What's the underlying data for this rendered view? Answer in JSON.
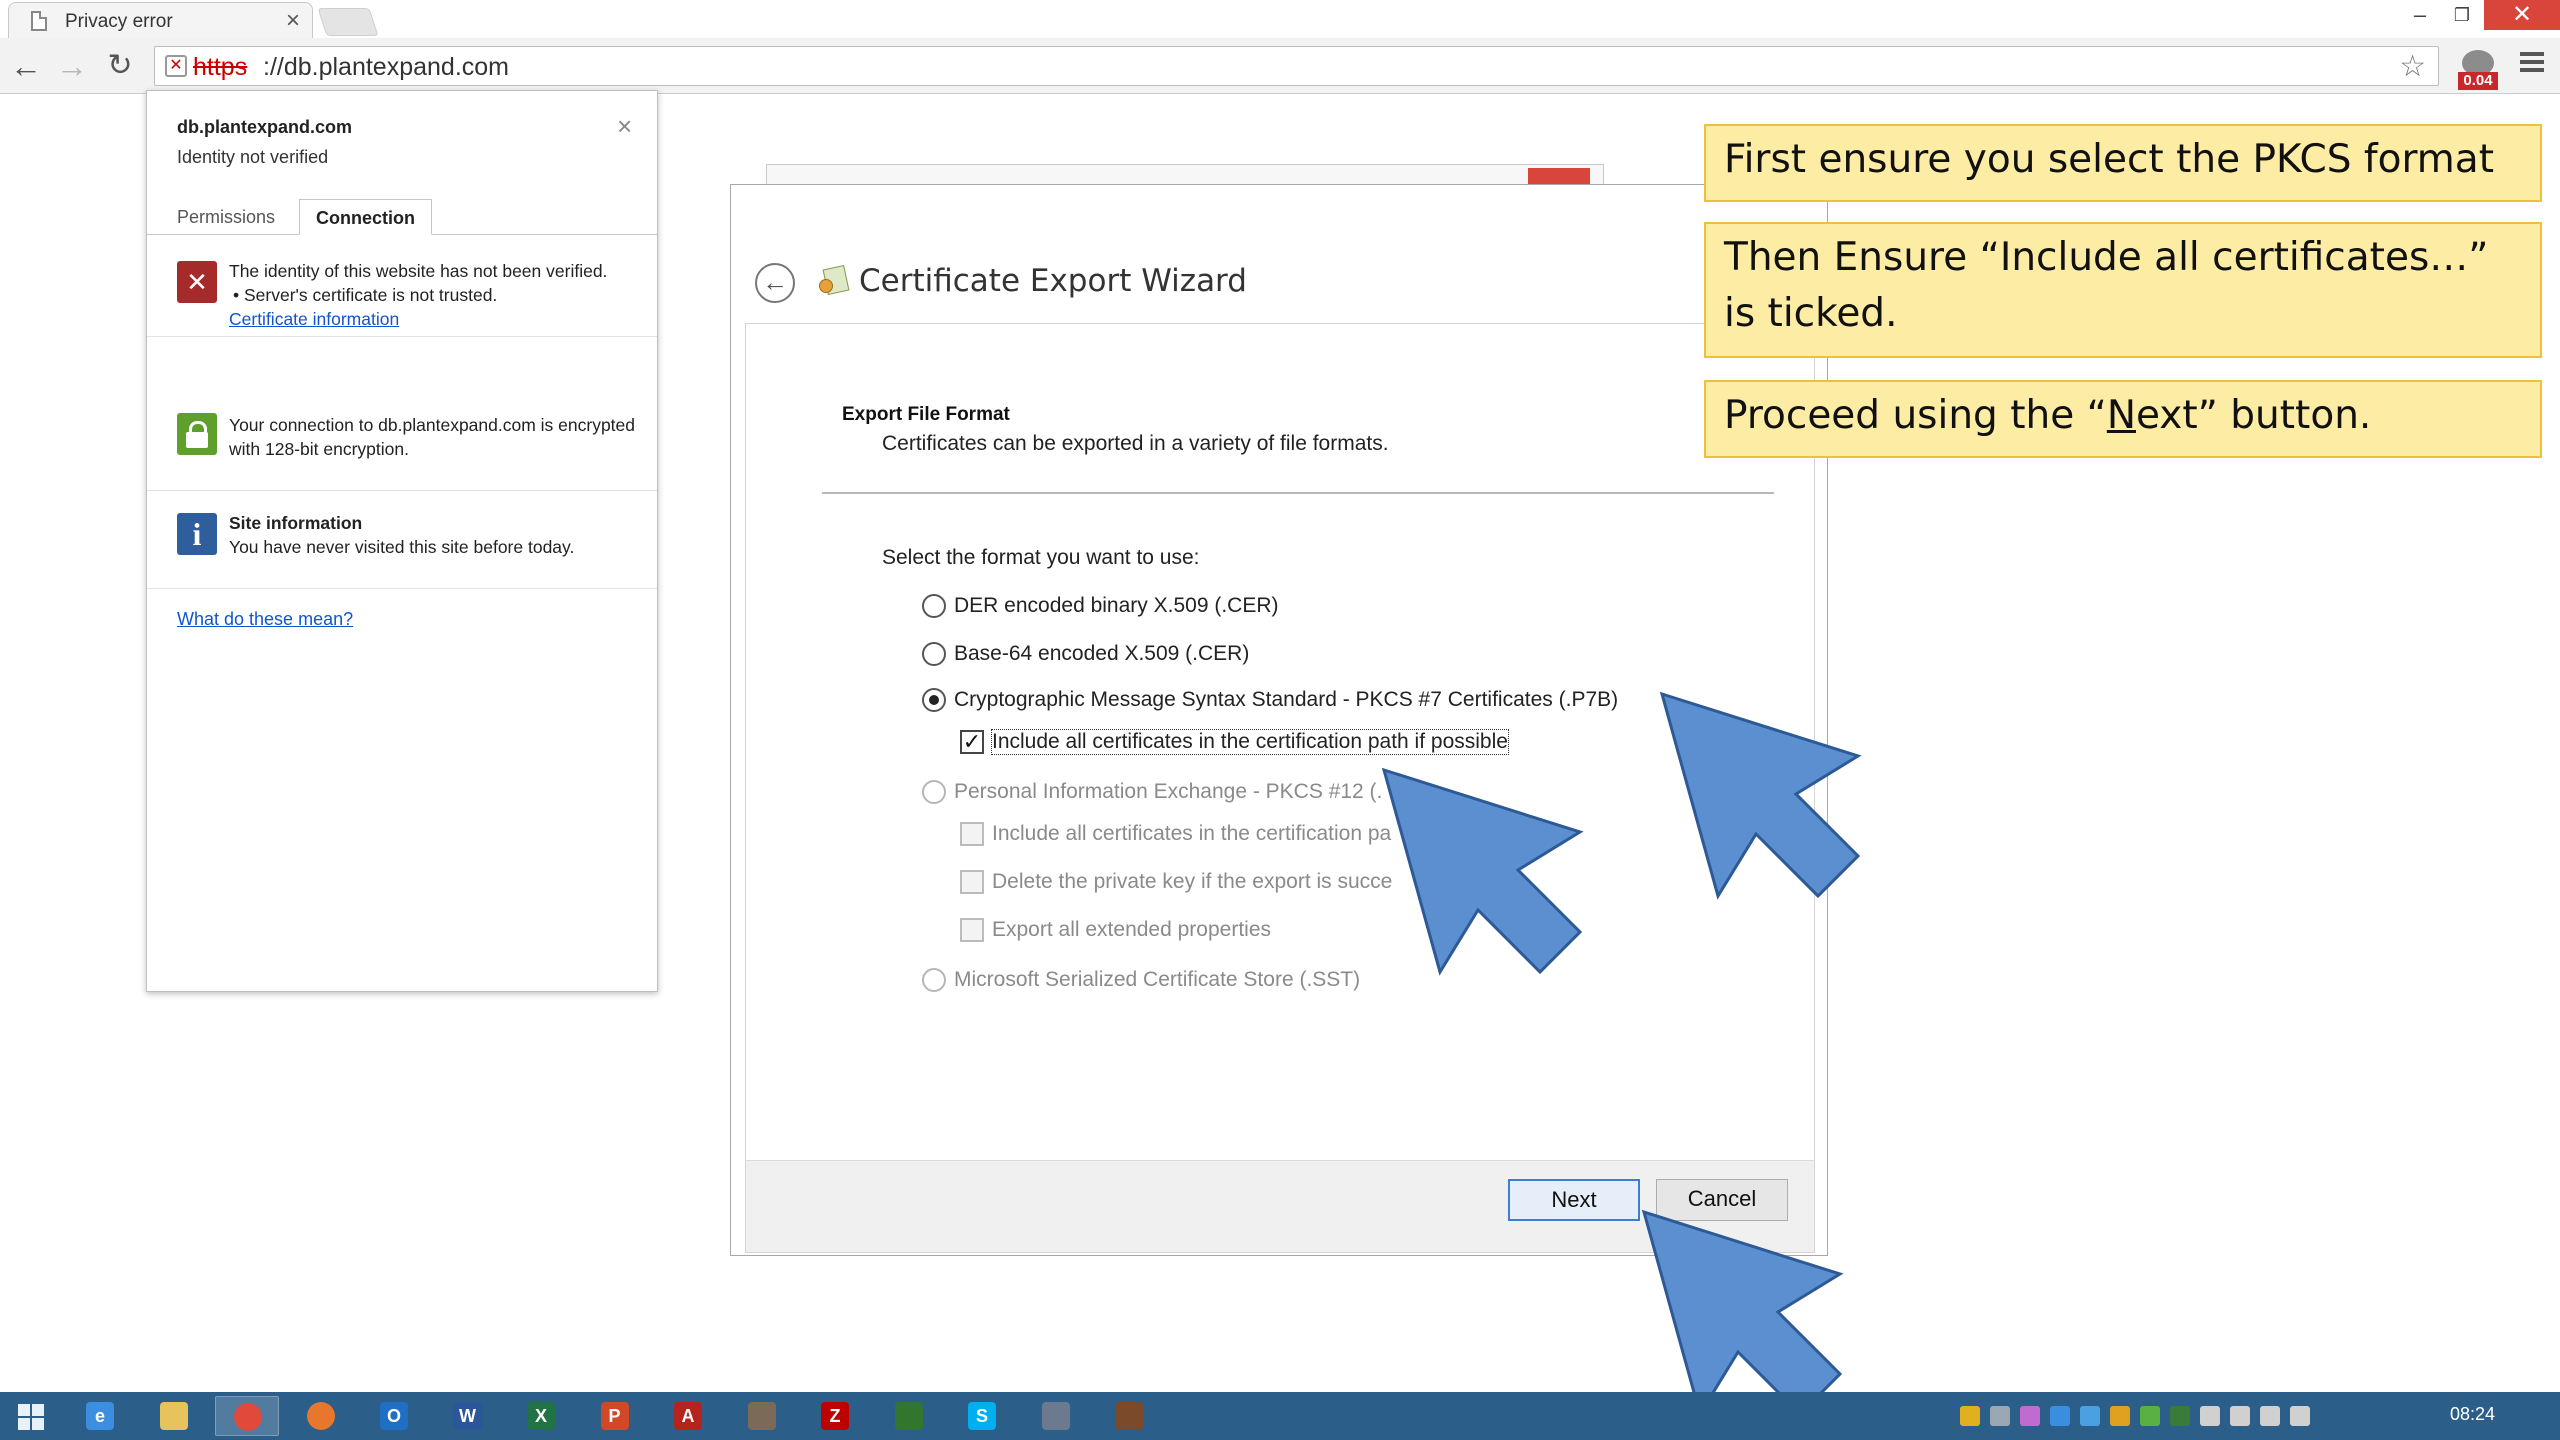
{
  "browser": {
    "tab_title": "Privacy error",
    "tab_close": "×",
    "window_min": "–",
    "window_max": "❐",
    "window_close": "✕",
    "url_scheme": "https",
    "url_rest": "://db.plantexpand.com",
    "extension_badge": "0.04",
    "icons": [
      "back-arrow-icon",
      "forward-arrow-icon",
      "reload-icon",
      "insecure-lock-icon",
      "bookmark-star-icon",
      "menu-icon"
    ]
  },
  "site_info": {
    "domain": "db.plantexpand.com",
    "identity": "Identity not verified",
    "close": "×",
    "tab_permissions": "Permissions",
    "tab_connection": "Connection",
    "identity_line1": "The identity of this website has not been verified.",
    "identity_line2": "• Server's certificate is not trusted.",
    "certificate_link": "Certificate information",
    "connection_text": "Your connection to db.plantexpand.com is encrypted with 128-bit encryption.",
    "site_info_title": "Site information",
    "site_info_text": "You have never visited this site before today.",
    "help_link": "What do these mean?"
  },
  "wizard": {
    "back": "←",
    "title": "Certificate Export Wizard",
    "heading": "Export File Format",
    "subheading": "Certificates can be exported in a variety of file formats.",
    "prompt": "Select the format you want to use:",
    "opt_der": "DER encoded binary X.509 (.CER)",
    "opt_base64": "Base-64 encoded X.509 (.CER)",
    "opt_pkcs7": "Cryptographic Message Syntax Standard - PKCS #7 Certificates (.P7B)",
    "chk_include_pkcs7": "Include all certificates in the certification path if possible",
    "opt_pkcs12": "Personal Information Exchange - PKCS #12 (.",
    "chk_include_pkcs12": "Include all certificates in the certification pa",
    "chk_delete_key": "Delete the private key if the export is succe",
    "chk_export_ext": "Export all extended properties",
    "opt_sst": "Microsoft Serialized Certificate Store (.SST)",
    "next": "Next",
    "cancel": "Cancel",
    "selected_format": "pkcs7",
    "include_all_checked": true
  },
  "callouts": {
    "c1": "First ensure you select the PKCS format",
    "c2": "Then Ensure “Include all certificates…” is ticked.",
    "c3_before": "Proceed using the “",
    "c3_key": "N",
    "c3_after": "ext” button."
  },
  "taskbar": {
    "clock": "08:24",
    "apps": [
      {
        "name": "internet-explorer",
        "label": "e",
        "color": "#3b8ee0"
      },
      {
        "name": "file-explorer",
        "label": "",
        "color": "#e8c25a"
      },
      {
        "name": "chrome",
        "label": "",
        "color": "#e04a3a"
      },
      {
        "name": "firefox",
        "label": "",
        "color": "#e8772e"
      },
      {
        "name": "outlook",
        "label": "O",
        "color": "#1f6fc4"
      },
      {
        "name": "word",
        "label": "W",
        "color": "#2b579a"
      },
      {
        "name": "excel",
        "label": "X",
        "color": "#217346"
      },
      {
        "name": "powerpoint",
        "label": "P",
        "color": "#d24726"
      },
      {
        "name": "acrobat",
        "label": "A",
        "color": "#b5231d"
      },
      {
        "name": "gimp",
        "label": "",
        "color": "#7b6a55"
      },
      {
        "name": "filezilla",
        "label": "Z",
        "color": "#bf0000"
      },
      {
        "name": "project",
        "label": "",
        "color": "#31752f"
      },
      {
        "name": "skype",
        "label": "S",
        "color": "#00aff0"
      },
      {
        "name": "certificate-manager",
        "label": "",
        "color": "#6b7a8f"
      },
      {
        "name": "media-app",
        "label": "",
        "color": "#7a4a2a"
      }
    ]
  },
  "colors": {
    "callout_bg": "#fdeca4",
    "callout_border": "#f0c03c",
    "arrow_fill": "#5b8fcf",
    "arrow_stroke": "#2d5a96",
    "taskbar": "#2b5f8a"
  }
}
